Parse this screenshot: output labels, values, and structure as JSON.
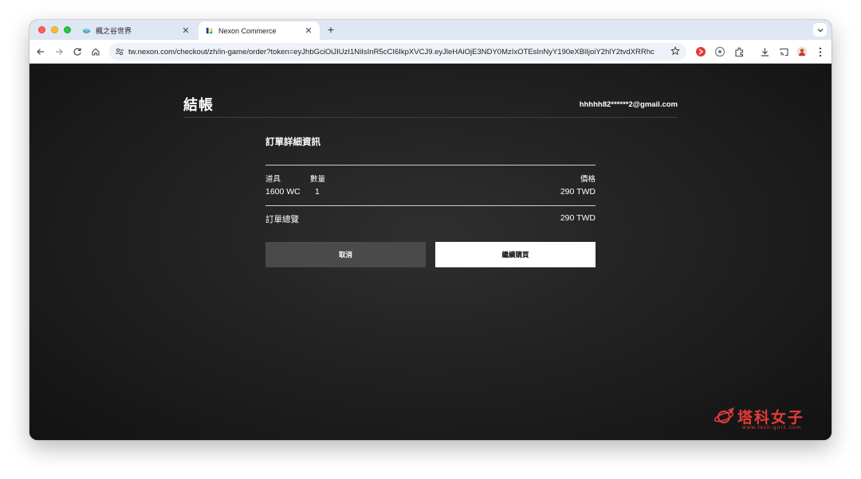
{
  "browser": {
    "tabs": [
      {
        "title": "楓之谷世界",
        "icon": "maplestory-fish-icon",
        "active": false
      },
      {
        "title": "Nexon Commerce",
        "icon": "nexon-logo-icon",
        "active": true
      }
    ],
    "new_tab_label": "+",
    "tab_close_glyph": "✕",
    "url": "tw.nexon.com/checkout/zh/in-game/order?token=eyJhbGciOiJIUzI1NiIsInR5cCI6IkpXVCJ9.eyJleHAiOjE3NDY0MzIxOTEsInNyY190eXBlIjoiY2hlY2tvdXRRhcGki..."
  },
  "checkout": {
    "page_title": "結帳",
    "user_email": "hhhhh82******2@gmail.com",
    "section_title": "訂單詳細資訊",
    "columns": {
      "item": "道具",
      "quantity": "數量",
      "price": "價格"
    },
    "items": [
      {
        "name": "1600 WC",
        "quantity": "1",
        "price": "290 TWD"
      }
    ],
    "summary_label": "訂單總覽",
    "summary_total": "290 TWD",
    "cancel_label": "取消",
    "continue_label": "繼續購買"
  },
  "watermark": {
    "text": "塔科女子",
    "url": "www.tech-girlz.com"
  },
  "colors": {
    "accent_red": "#e83a3a",
    "page_bg": "#1a1a1a",
    "cancel_bg": "#4a4a4a",
    "continue_bg": "#ffffff"
  }
}
